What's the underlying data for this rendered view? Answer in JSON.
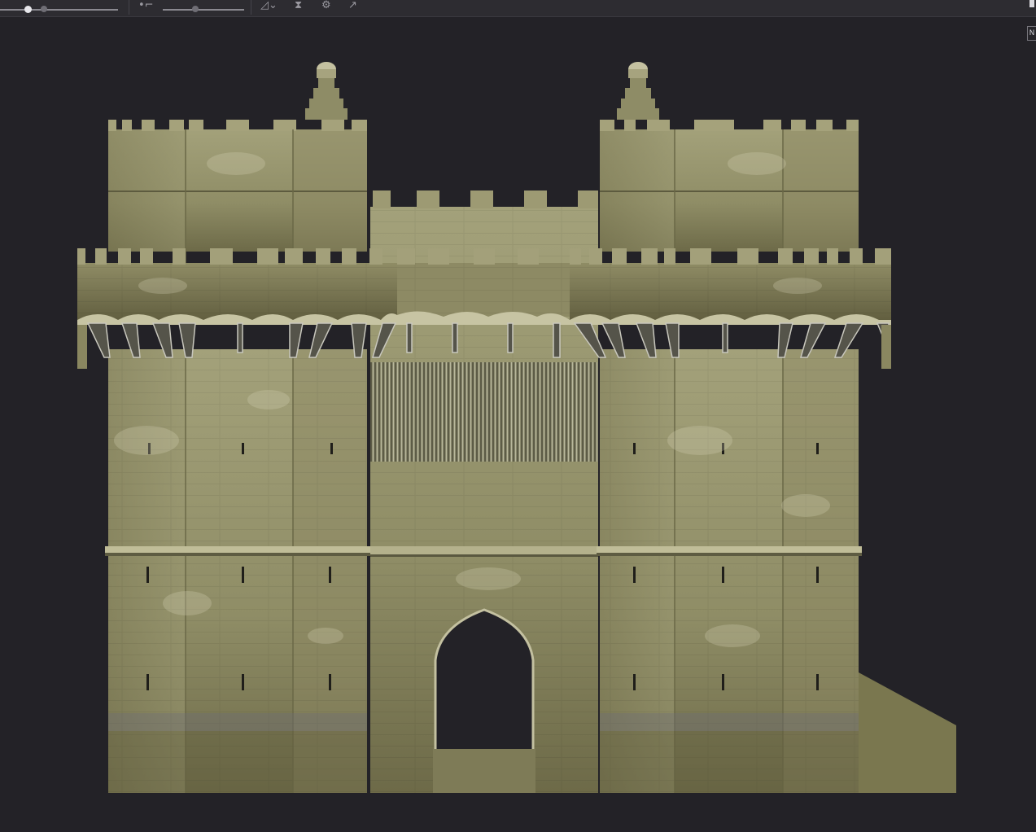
{
  "toolbar": {
    "slider_1_value": 0.2,
    "slider_2_value": 0.4,
    "icons": [
      "point-tool-icon",
      "triangle-dropdown-icon",
      "symmetry-icon",
      "gear-icon",
      "export-icon"
    ]
  },
  "side_button": {
    "label": "N"
  },
  "scene": {
    "subject": "castle-gate-model",
    "background_color": "#232227",
    "stone_color": "#9b9a72",
    "stone_dark": "#6f6e4c",
    "stone_light": "#b7b48e"
  }
}
